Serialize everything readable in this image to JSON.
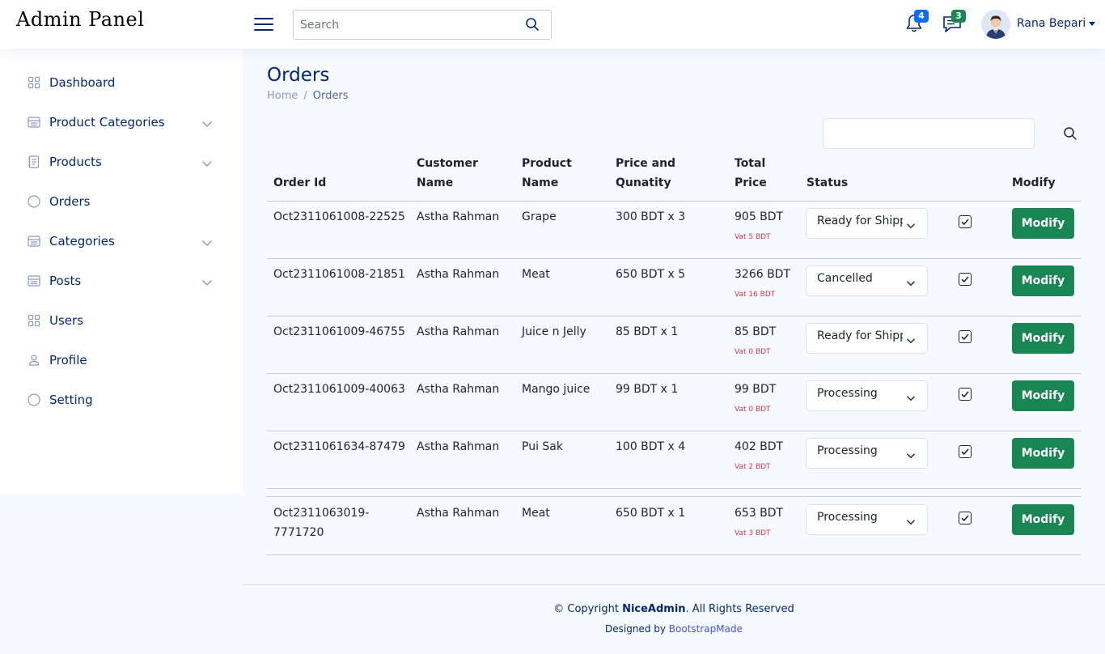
{
  "header": {
    "brand": "Admin Panel",
    "search_placeholder": "Search",
    "notifications_count": "4",
    "messages_count": "3",
    "user_name": "Rana Bepari"
  },
  "sidebar": {
    "items": [
      {
        "label": "Dashboard",
        "icon": "grid-icon"
      },
      {
        "label": "Product Categories",
        "icon": "layout-text-icon"
      },
      {
        "label": "Products",
        "icon": "journal-text-icon"
      },
      {
        "label": "Orders",
        "icon": "circle-icon"
      },
      {
        "label": "Categories",
        "icon": "layout-text-icon"
      },
      {
        "label": "Posts",
        "icon": "layout-text-icon"
      },
      {
        "label": "Users",
        "icon": "grid-icon"
      },
      {
        "label": "Profile",
        "icon": "person-icon"
      },
      {
        "label": "Setting",
        "icon": "circle-icon"
      }
    ]
  },
  "page": {
    "title": "Orders",
    "breadcrumb_home": "Home",
    "breadcrumb_sep": "/",
    "breadcrumb_current": "Orders"
  },
  "table": {
    "headers": {
      "order_id": "Order Id",
      "customer_1": "Customer",
      "customer_2": "Name",
      "product_1": "Product",
      "product_2": "Name",
      "price_1": "Price and",
      "price_2": "Qunatity",
      "total_1": "Total",
      "total_2": "Price",
      "status": "Status",
      "modify": "Modify"
    },
    "modify_label": "Modify",
    "rows": [
      {
        "order_id": "Oct2311061008-22525",
        "customer": "Astha Rahman",
        "product": "Grape",
        "price_qty": "300 BDT x 3",
        "total": "905 BDT",
        "vat": "Vat 5 BDT",
        "status": "Ready for Shipping"
      },
      {
        "order_id": "Oct2311061008-21851",
        "customer": "Astha Rahman",
        "product": "Meat",
        "price_qty": "650 BDT x 5",
        "total": "3266 BDT",
        "vat": "Vat 16 BDT",
        "status": "Cancelled"
      },
      {
        "order_id": "Oct2311061009-46755",
        "customer": "Astha Rahman",
        "product": "Juice n Jelly",
        "price_qty": "85 BDT x 1",
        "total": "85 BDT",
        "vat": "Vat 0 BDT",
        "status": "Ready for Shipping"
      },
      {
        "order_id": "Oct2311061009-40063",
        "customer": "Astha Rahman",
        "product": "Mango juice",
        "price_qty": "99 BDT x 1",
        "total": "99 BDT",
        "vat": "Vat 0 BDT",
        "status": "Processing"
      },
      {
        "order_id": "Oct2311061634-87479",
        "customer": "Astha Rahman",
        "product": "Pui Sak",
        "price_qty": "100 BDT x 4",
        "total": "402 BDT",
        "vat": "Vat 2 BDT",
        "status": "Processing"
      },
      {
        "order_id_1": "Oct2311063019-",
        "order_id_2": "7771720",
        "customer": "Astha Rahman",
        "product": "Meat",
        "price_qty": "650 BDT x 1",
        "total": "653 BDT",
        "vat": "Vat 3 BDT",
        "status": "Processing"
      }
    ]
  },
  "footer": {
    "copyright_prefix": "© Copyright ",
    "copyright_brand": "NiceAdmin",
    "copyright_suffix": ". All Rights Reserved",
    "credits_prefix": "Designed by ",
    "credits_link": "BootstrapMade"
  },
  "colors": {
    "primary_text": "#012970",
    "modify_button": "#198754",
    "notification_badge": "#0d6efd",
    "message_badge": "#198754",
    "vat_text": "#dc3545",
    "page_background": "#f6f9ff"
  }
}
